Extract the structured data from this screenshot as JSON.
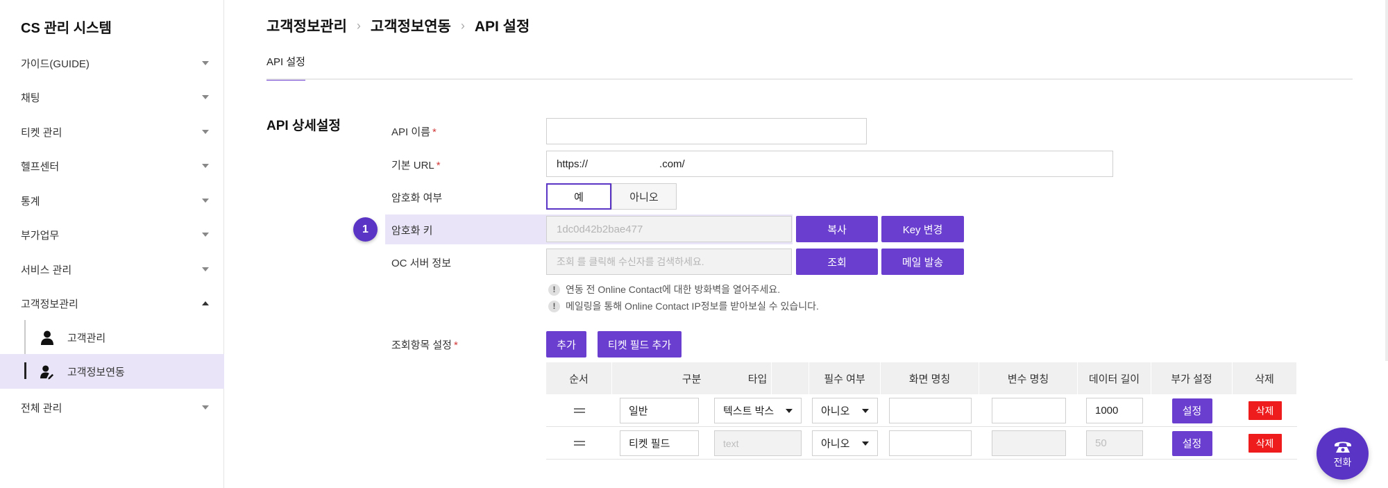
{
  "sidebar": {
    "brand": "CS 관리 시스템",
    "items": [
      {
        "label": "가이드(GUIDE)"
      },
      {
        "label": "채팅"
      },
      {
        "label": "티켓 관리"
      },
      {
        "label": "헬프센터"
      },
      {
        "label": "통계"
      },
      {
        "label": "부가업무"
      },
      {
        "label": "서비스 관리"
      },
      {
        "label": "고객정보관리"
      },
      {
        "label": "전체 관리"
      }
    ],
    "sub_items": [
      {
        "label": "고객관리"
      },
      {
        "label": "고객정보연동"
      }
    ]
  },
  "header": {
    "breadcrumb": [
      "고객정보관리",
      "고객정보연동",
      "API 설정"
    ],
    "tab": "API 설정"
  },
  "section": {
    "title": "API 상세설정"
  },
  "form": {
    "api_name": {
      "label": "API 이름",
      "value": ""
    },
    "base_url": {
      "label": "기본 URL",
      "value_prefix": "https://",
      "value_suffix": ".com/"
    },
    "encryption": {
      "label": "암호화 여부",
      "yes": "예",
      "no": "아니오",
      "selected": "예"
    },
    "encryption_key": {
      "label": "암호화 키",
      "value": "1dc0d42b2bae477",
      "copy": "복사",
      "change": "Key 변경"
    },
    "oc_server": {
      "label": "OC 서버 정보",
      "placeholder": "조회 를 클릭해 수신자를 검색하세요.",
      "lookup": "조회",
      "mail": "메일 발송"
    },
    "notices": [
      "연동 전 Online Contact에 대한 방화벽을 열어주세요.",
      "메일링을 통해 Online Contact IP정보를 받아보실 수 있습니다."
    ],
    "query_items": {
      "label": "조회항목 설정",
      "add": "추가",
      "add_ticket_field": "티켓 필드 추가"
    }
  },
  "step_badge": "1",
  "table": {
    "headers": [
      "순서",
      "구분",
      "타입",
      "필수 여부",
      "화면 명칭",
      "변수 명칭",
      "데이터 길이",
      "부가 설정",
      "삭제"
    ],
    "rows": [
      {
        "category": "일반",
        "type": "텍스트 박스",
        "required": "아니오",
        "screen_name": "",
        "var_name": "",
        "length": "1000",
        "setting": "설정",
        "delete": "삭제"
      },
      {
        "category": "티켓 필드",
        "type": "text",
        "required": "아니오",
        "screen_name": "",
        "var_name": "",
        "length": "50",
        "setting": "설정",
        "delete": "삭제"
      }
    ]
  },
  "call_button": "전화",
  "colors": {
    "accent": "#6a3fd0",
    "danger": "#ee1c1c",
    "highlight": "#e9e4f7"
  }
}
